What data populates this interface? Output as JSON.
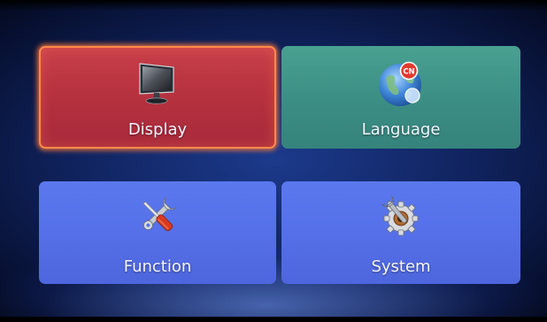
{
  "menu": {
    "tiles": [
      {
        "label": "Display",
        "icon": "monitor-icon",
        "selected": true,
        "color": "#b7323f"
      },
      {
        "label": "Language",
        "icon": "globe-icon",
        "color": "#3c8f85",
        "badges": [
          "CN"
        ]
      },
      {
        "label": "Function",
        "icon": "tools-icon",
        "color": "#5570e8"
      },
      {
        "label": "System",
        "icon": "gear-wrench-icon",
        "color": "#5570e8"
      }
    ],
    "highlight_color": "#ff8a4a"
  }
}
